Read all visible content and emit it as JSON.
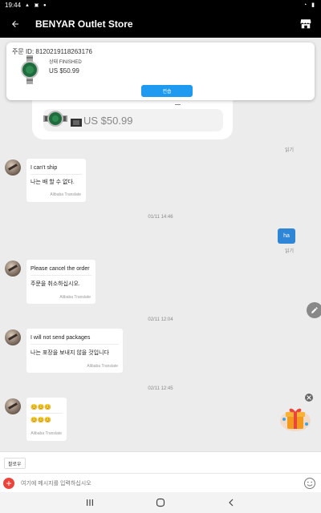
{
  "status_bar": {
    "time": "19:44"
  },
  "app_bar": {
    "title": "BENYAR Outlet Store"
  },
  "order_card": {
    "order_id": "주문 ID: 8120219118263176",
    "status": "상태 FINISHED",
    "price": "US $50.99",
    "confirm_label": "컨숍"
  },
  "product_bubble": {
    "price": "US $50.99"
  },
  "read_label": "읽기",
  "timestamps": [
    "01/11 14:46",
    "02/11 12:04",
    "02/11 12:45"
  ],
  "messages": [
    {
      "original": "I can't ship",
      "translated": "나는 배 할 수 없다.",
      "translator": "Alibaba Translate"
    },
    {
      "original": "Please cancel the order",
      "translated": "주문을 취소하십시오.",
      "translator": "Alibaba Translate"
    },
    {
      "original": "I will not send packages",
      "translated": "나는 포장을 보내지 않을 것입니다",
      "translator": "Alibaba Translate"
    },
    {
      "original": "😊😊😊",
      "translated": "😊😊😊",
      "translator": "Alibaba Translate"
    }
  ],
  "my_message": {
    "text": "ha"
  },
  "quick_reply": {
    "label": "팔로우"
  },
  "input": {
    "placeholder": "여기에 메시지를 입력하십시오",
    "value": ""
  },
  "colors": {
    "accent": "#1e9bf0",
    "my_bubble": "#2f86d6",
    "add_button": "#e8453c",
    "app_bar": "#000000"
  },
  "icons": [
    "back-arrow-icon",
    "store-icon",
    "add-icon",
    "emoji-icon",
    "edit-icon",
    "gift-icon",
    "close-icon",
    "recents-icon",
    "home-icon",
    "back-icon"
  ]
}
